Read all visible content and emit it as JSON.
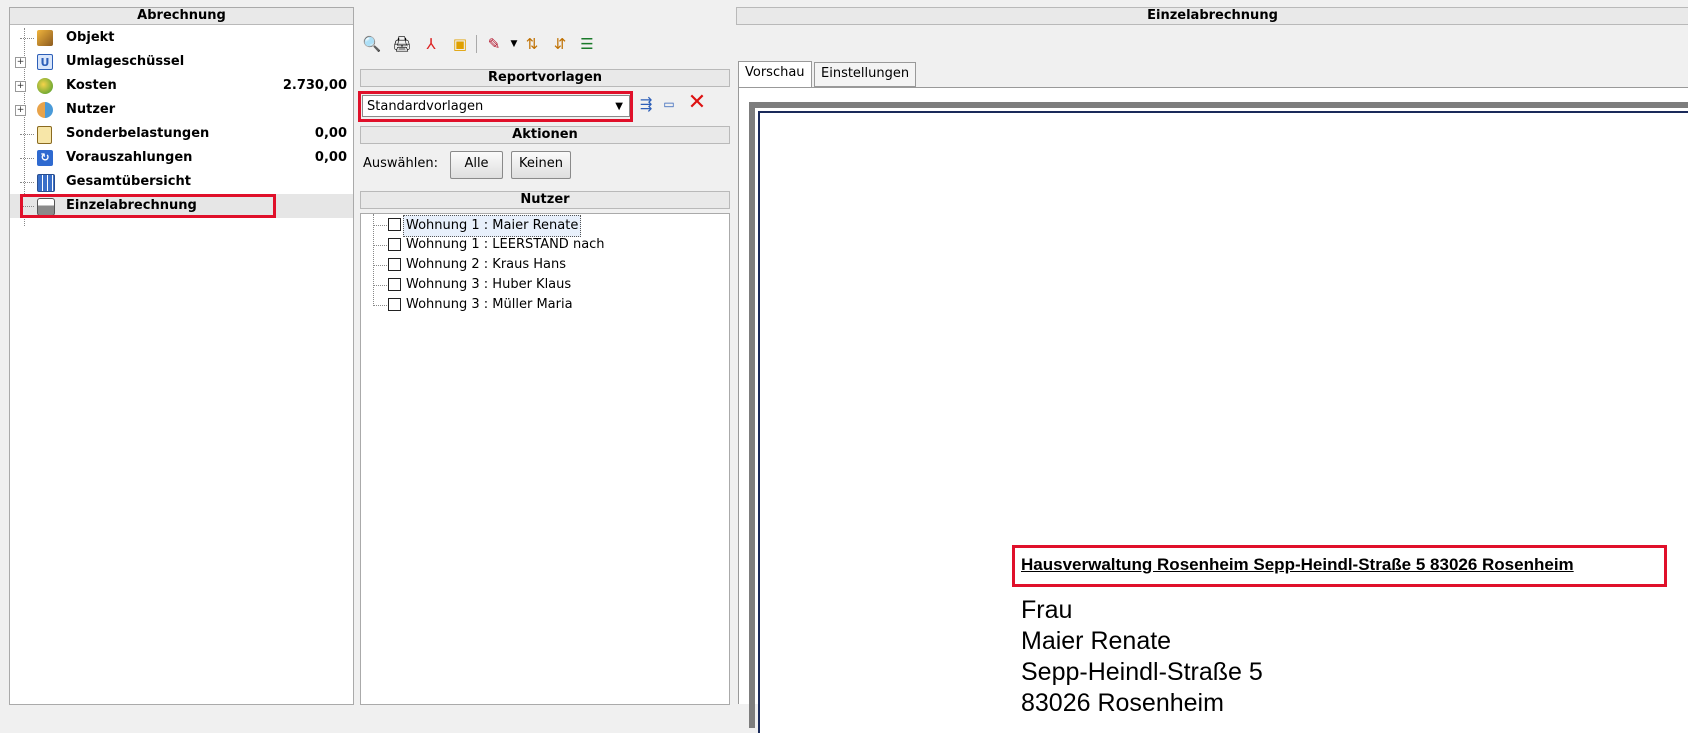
{
  "left_panel": {
    "title": "Abrechnung",
    "items": [
      {
        "label": "Objekt",
        "value": ""
      },
      {
        "label": "Umlageschüssel",
        "value": ""
      },
      {
        "label": "Kosten",
        "value": "2.730,00"
      },
      {
        "label": "Nutzer",
        "value": ""
      },
      {
        "label": "Sonderbelastungen",
        "value": "0,00"
      },
      {
        "label": "Vorauszahlungen",
        "value": "0,00"
      },
      {
        "label": "Gesamtübersicht",
        "value": ""
      },
      {
        "label": "Einzelabrechnung",
        "value": ""
      }
    ]
  },
  "middle": {
    "reportvorlagen_title": "Reportvorlagen",
    "report_selected": "Standardvorlagen",
    "aktionen_title": "Aktionen",
    "auswaehlen_label": "Auswählen:",
    "alle_button": "Alle",
    "keinen_button": "Keinen",
    "nutzer_title": "Nutzer",
    "nutzer": [
      "Wohnung 1 : Maier Renate",
      "Wohnung 1 : LEERSTAND nach",
      "Wohnung 2 : Kraus Hans",
      "Wohnung 3 : Huber Klaus",
      "Wohnung 3 : Müller Maria"
    ]
  },
  "right": {
    "title": "Einzelabrechnung",
    "tabs": [
      "Vorschau",
      "Einstellungen"
    ],
    "sender_line": "Hausverwaltung Rosenheim Sepp-Heindl-Straße 5 83026 Rosenheim",
    "address": [
      "Frau",
      "Maier Renate",
      "Sepp-Heindl-Straße 5",
      "83026 Rosenheim"
    ]
  }
}
